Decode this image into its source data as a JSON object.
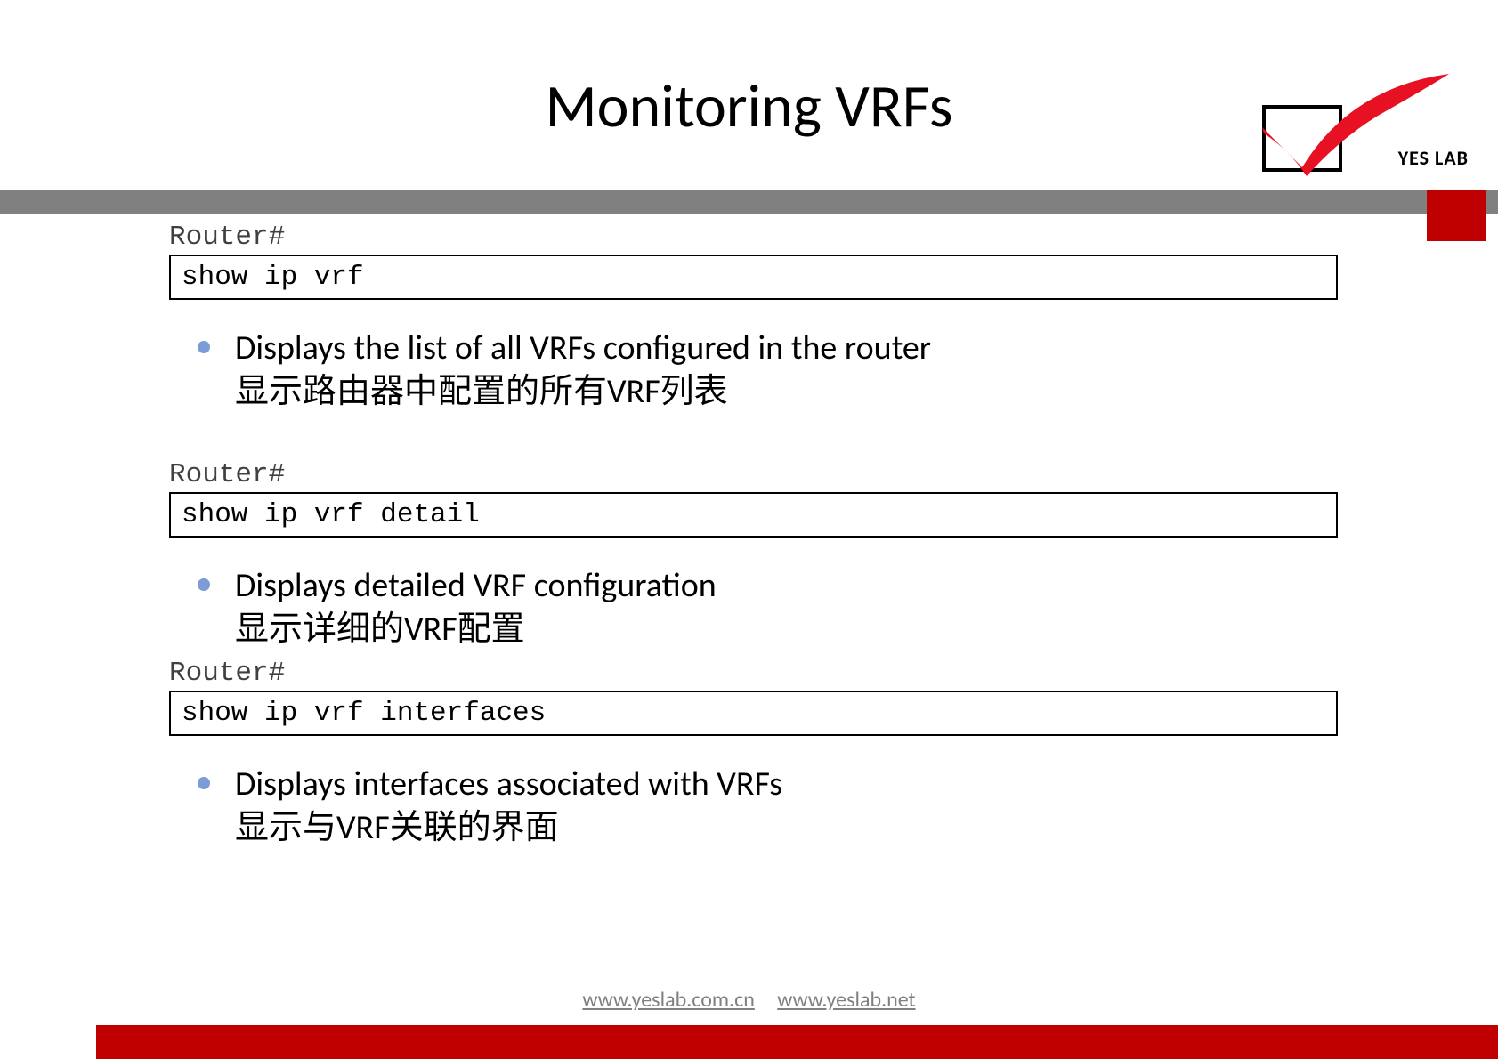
{
  "slide": {
    "title": "Monitoring VRFs"
  },
  "logo": {
    "text": "YES LAB"
  },
  "sections": [
    {
      "prompt": "Router#",
      "command": "show ip vrf",
      "description_en": "Displays the list of all VRFs configured in the router",
      "description_cn": "显示路由器中配置的所有VRF列表"
    },
    {
      "prompt": "Router#",
      "command": "show ip vrf detail",
      "description_en": "Displays detailed VRF configuration",
      "description_cn": "显示详细的VRF配置"
    },
    {
      "prompt": "Router#",
      "command": "show ip vrf interfaces",
      "description_en": "Displays interfaces associated with VRFs",
      "description_cn": "显示与VRF关联的界面"
    }
  ],
  "footer": {
    "link1": "www.yeslab.com.cn",
    "link2": "www.yeslab.net"
  }
}
